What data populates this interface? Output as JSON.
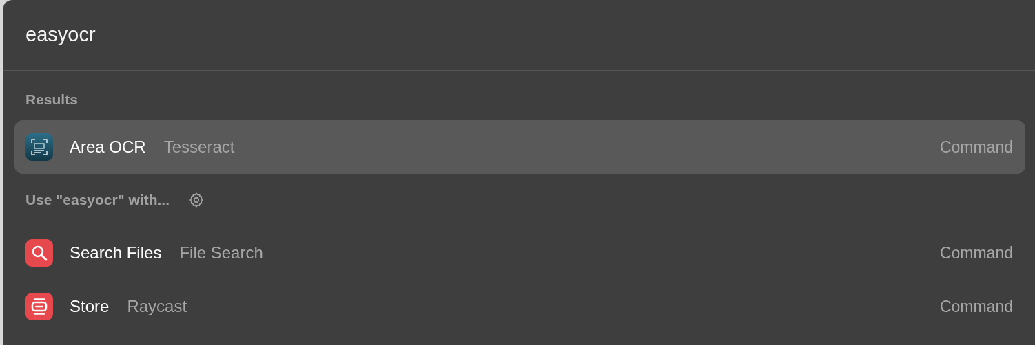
{
  "search": {
    "value": "easyocr"
  },
  "sections": [
    {
      "title": "Results",
      "kind": "plain",
      "items": [
        {
          "kind": "ocr",
          "title": "Area OCR",
          "subtitle": "Tesseract",
          "accessory": "Command",
          "selected": true
        }
      ]
    },
    {
      "title": "Use \"easyocr\" with...",
      "kind": "settings",
      "items": [
        {
          "kind": "search",
          "title": "Search Files",
          "subtitle": "File Search",
          "accessory": "Command",
          "selected": false
        },
        {
          "kind": "store",
          "title": "Store",
          "subtitle": "Raycast",
          "accessory": "Command",
          "selected": false
        }
      ]
    }
  ]
}
